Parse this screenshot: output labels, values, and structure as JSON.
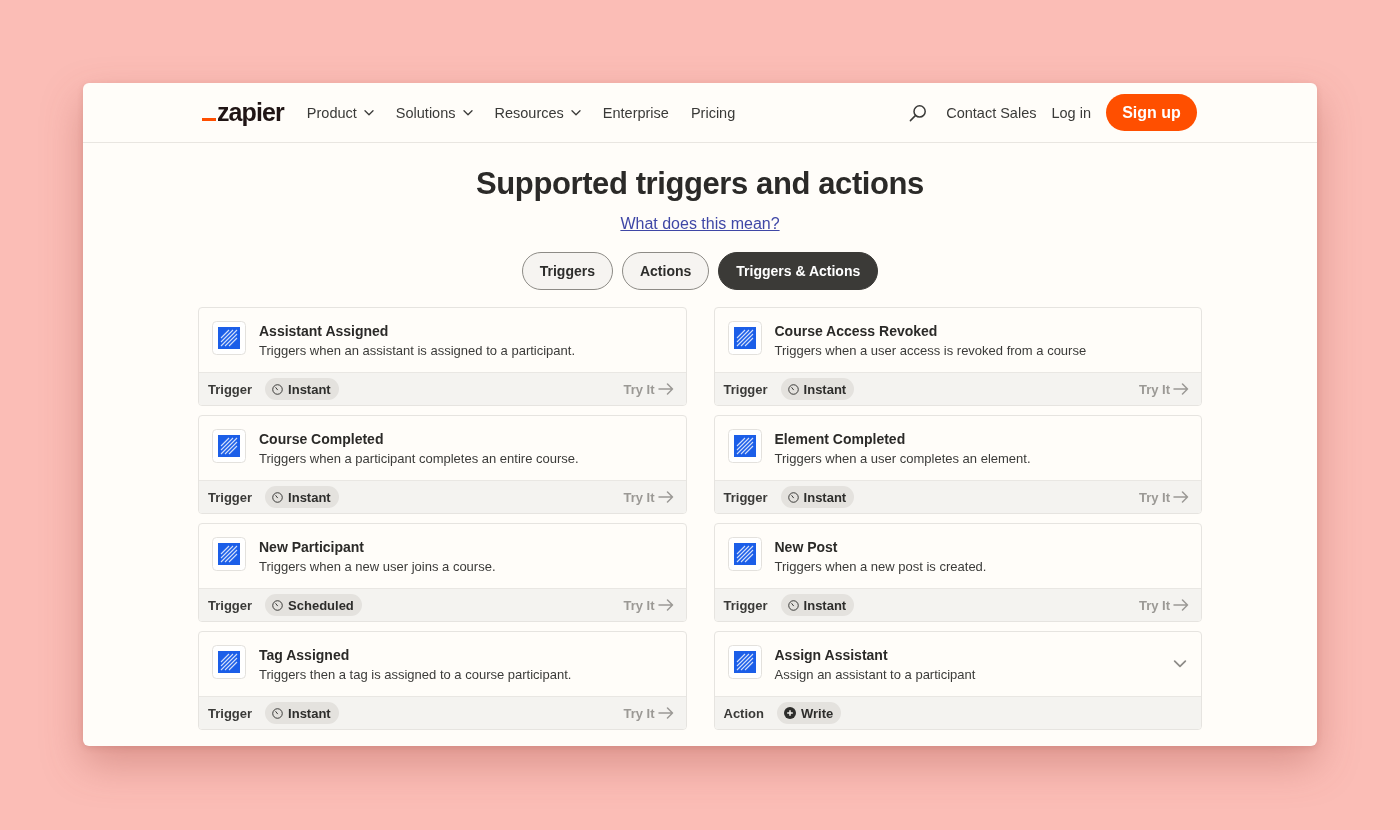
{
  "navbar": {
    "logo": "zapier",
    "menu": [
      {
        "label": "Product",
        "dropdown": true
      },
      {
        "label": "Solutions",
        "dropdown": true
      },
      {
        "label": "Resources",
        "dropdown": true
      },
      {
        "label": "Enterprise",
        "dropdown": false
      },
      {
        "label": "Pricing",
        "dropdown": false
      }
    ],
    "contact": "Contact Sales",
    "login": "Log in",
    "signup": "Sign up"
  },
  "heading": {
    "title": "Supported triggers and actions",
    "help_link": "What does this mean?"
  },
  "filters": [
    {
      "label": "Triggers",
      "selected": false
    },
    {
      "label": "Actions",
      "selected": false
    },
    {
      "label": "Triggers & Actions",
      "selected": true
    }
  ],
  "cards": [
    {
      "kind": "trigger",
      "title": "Assistant Assigned",
      "description": "Triggers when an assistant is assigned to a participant.",
      "type": "Trigger",
      "mode": {
        "kind": "instant",
        "label": "Instant"
      },
      "try_label": "Try It"
    },
    {
      "kind": "trigger",
      "title": "Course Access Revoked",
      "description": "Triggers when a user access is revoked from a course",
      "type": "Trigger",
      "mode": {
        "kind": "instant",
        "label": "Instant"
      },
      "try_label": "Try It"
    },
    {
      "kind": "trigger",
      "title": "Course Completed",
      "description": "Triggers when a participant completes an entire course.",
      "type": "Trigger",
      "mode": {
        "kind": "instant",
        "label": "Instant"
      },
      "try_label": "Try It"
    },
    {
      "kind": "trigger",
      "title": "Element Completed",
      "description": "Triggers when a user completes an element.",
      "type": "Trigger",
      "mode": {
        "kind": "instant",
        "label": "Instant"
      },
      "try_label": "Try It"
    },
    {
      "kind": "trigger",
      "title": "New Participant",
      "description": "Triggers when a new user joins a course.",
      "type": "Trigger",
      "mode": {
        "kind": "scheduled",
        "label": "Scheduled"
      },
      "try_label": "Try It"
    },
    {
      "kind": "trigger",
      "title": "New Post",
      "description": "Triggers when a new post is created.",
      "type": "Trigger",
      "mode": {
        "kind": "instant",
        "label": "Instant"
      },
      "try_label": "Try It"
    },
    {
      "kind": "trigger",
      "title": "Tag Assigned",
      "description": "Triggers then a tag is assigned to a course participant.",
      "type": "Trigger",
      "mode": {
        "kind": "instant",
        "label": "Instant"
      },
      "try_label": "Try It"
    },
    {
      "kind": "action",
      "title": "Assign Assistant",
      "description": "Assign an assistant to a participant",
      "type": "Action",
      "mode": {
        "kind": "write",
        "label": "Write"
      },
      "expanded": false
    }
  ]
}
